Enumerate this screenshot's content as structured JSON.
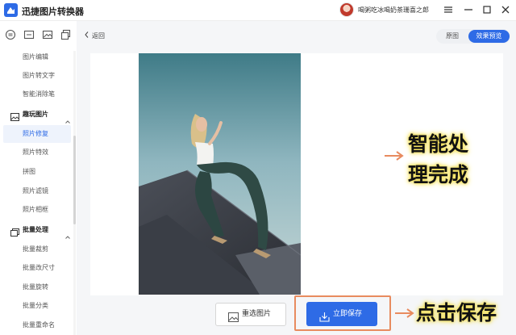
{
  "app": {
    "title": "迅捷图片转换器",
    "username": "喝粥吃冰喝奶茶珊喜之郎"
  },
  "rail": {
    "icons": [
      "convert-icon",
      "pdf-icon",
      "image-icon",
      "copy-icon"
    ]
  },
  "sidebar": {
    "items_top": [
      {
        "label": "图片编辑"
      },
      {
        "label": "图片转文字"
      },
      {
        "label": "智能消除笔"
      }
    ],
    "group_fun": {
      "label": "趣玩图片"
    },
    "fun_items": [
      {
        "label": "照片修复",
        "active": true
      },
      {
        "label": "照片特效"
      },
      {
        "label": "拼图"
      },
      {
        "label": "照片滤镜"
      },
      {
        "label": "照片相框"
      }
    ],
    "group_batch": {
      "label": "批量处理"
    },
    "batch_items": [
      {
        "label": "批量裁剪"
      },
      {
        "label": "批量改尺寸"
      },
      {
        "label": "批量旋转"
      },
      {
        "label": "批量分类"
      },
      {
        "label": "批量重命名"
      }
    ]
  },
  "main": {
    "back_label": "返回",
    "toggle": {
      "original": "原图",
      "effect": "效果预览"
    },
    "reselect_label": "重选图片",
    "save_label": "立即保存"
  },
  "annotations": {
    "line1": "智能处",
    "line2": "理完成",
    "save_hint": "点击保存"
  },
  "colors": {
    "accent": "#2e6be6",
    "highlight": "#f4e15a",
    "frame": "#e88b5f"
  }
}
